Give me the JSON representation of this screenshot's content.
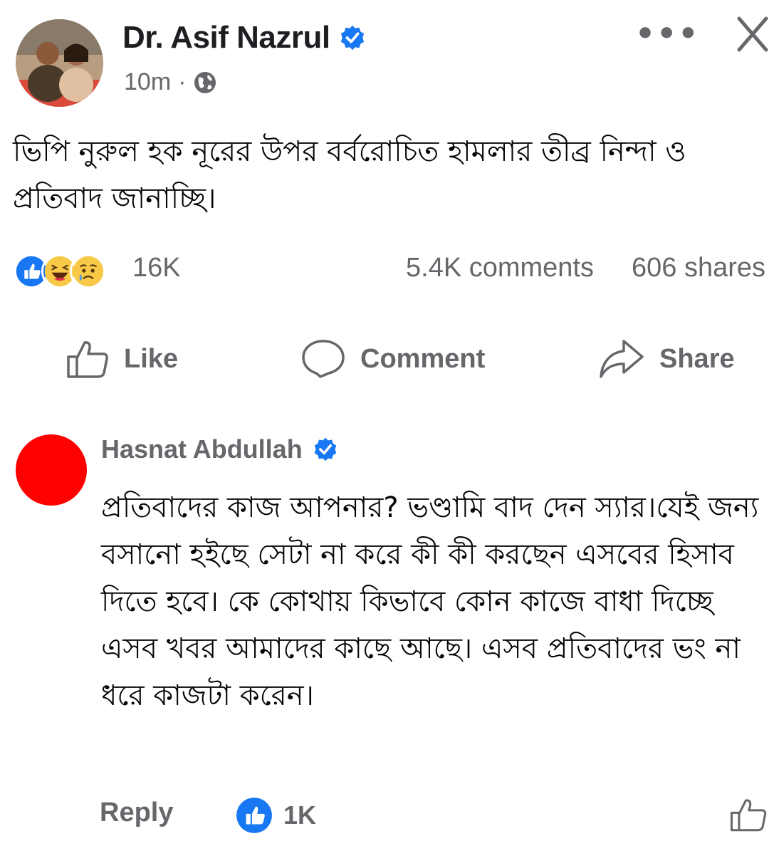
{
  "post": {
    "author": "Dr. Asif Nazrul",
    "time": "10m",
    "separator": "·",
    "body": "ভিপি নুরুল হক নূরের উপর বর্বরোচিত হামলার তীব্র নিন্দা ও প্রতিবাদ জানাচ্ছি।",
    "reactions_count": "16K",
    "comments_count": "5.4K comments",
    "shares_count": "606 shares",
    "reaction_icons": [
      "like-icon",
      "haha-icon",
      "sad-icon"
    ]
  },
  "actions": {
    "like": "Like",
    "comment": "Comment",
    "share": "Share"
  },
  "comment": {
    "author": "Hasnat Abdullah",
    "body": "প্রতিবাদের কাজ আপনার? ভণ্ডামি বাদ দেন স্যার।যেই জন্য বসানো হইছে সেটা না করে কী কী করছেন এসবের হিসাব দিতে হবে। কে কোথায় কিভাবে কোন কাজে বাধা দিচ্ছে এসব খবর আমাদের কাছে আছে। এসব প্রতিবাদের ভং না ধরে কাজটা করেন।",
    "reply_label": "Reply",
    "like_count": "1K"
  },
  "colors": {
    "facebook_blue": "#1877f2",
    "secondary_text": "#65676b",
    "commenter_avatar": "#ff0000"
  }
}
